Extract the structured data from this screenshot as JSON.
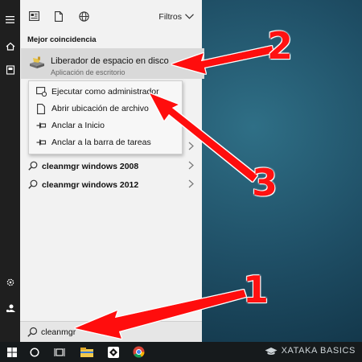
{
  "panel": {
    "filters_label": "Filtros",
    "section_title": "Mejor coincidencia",
    "best_match": {
      "title": "Liberador de espacio en disco",
      "subtitle": "Aplicación de escritorio"
    },
    "context_menu": [
      {
        "label": "Ejecutar como administrador",
        "icon": "run-as-admin-icon"
      },
      {
        "label": "Abrir ubicación de archivo",
        "icon": "open-file-location-icon"
      },
      {
        "label": "Anclar a Inicio",
        "icon": "pin-icon"
      },
      {
        "label": "Anclar a la barra de tareas",
        "icon": "pin-icon"
      }
    ],
    "results": [
      {
        "bold": "cleanmgr windows 2008"
      },
      {
        "bold": "cleanmgr windows 2012"
      }
    ]
  },
  "search": {
    "value": "cleanmgr"
  },
  "taskbar": {
    "brand": "XATAKA BASICS"
  },
  "annotations": {
    "one": "1",
    "two": "2",
    "three": "3",
    "color": "#ff1111"
  }
}
